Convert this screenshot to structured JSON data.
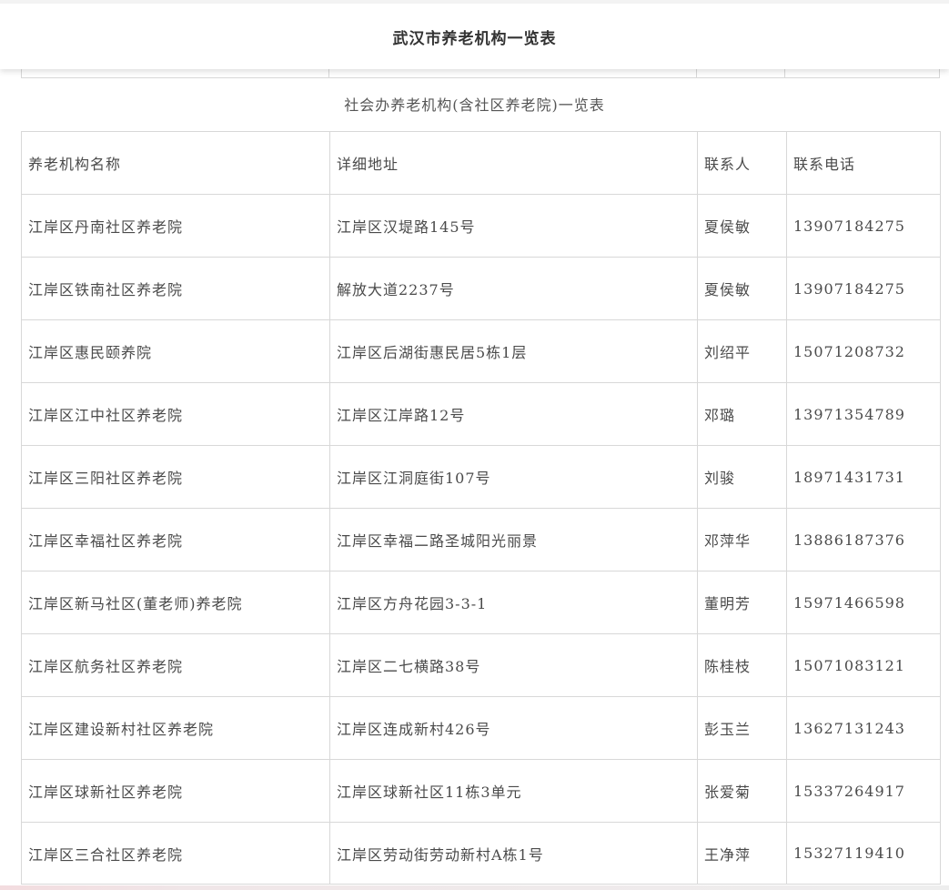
{
  "header": {
    "title": "武汉市养老机构一览表"
  },
  "subtitle": "社会办养老机构(含社区养老院)一览表",
  "table": {
    "columns": [
      "养老机构名称",
      "详细地址",
      "联系人",
      "联系电话"
    ],
    "rows": [
      [
        "江岸区丹南社区养老院",
        "江岸区汉堤路145号",
        "夏侯敏",
        "13907184275"
      ],
      [
        "江岸区铁南社区养老院",
        "解放大道2237号",
        "夏侯敏",
        "13907184275"
      ],
      [
        "江岸区惠民颐养院",
        "江岸区后湖街惠民居5栋1层",
        "刘绍平",
        "15071208732"
      ],
      [
        "江岸区江中社区养老院",
        "江岸区江岸路12号",
        "邓璐",
        "13971354789"
      ],
      [
        "江岸区三阳社区养老院",
        "江岸区江洞庭街107号",
        "刘骏",
        "18971431731"
      ],
      [
        "江岸区幸福社区养老院",
        "江岸区幸福二路圣城阳光丽景",
        "邓萍华",
        "13886187376"
      ],
      [
        "江岸区新马社区(董老师)养老院",
        "江岸区方舟花园3-3-1",
        "董明芳",
        "15971466598"
      ],
      [
        "江岸区航务社区养老院",
        "江岸区二七横路38号",
        "陈桂枝",
        "15071083121"
      ],
      [
        "江岸区建设新村社区养老院",
        "江岸区连成新村426号",
        "彭玉兰",
        "13627131243"
      ],
      [
        "江岸区球新社区养老院",
        "江岸区球新社区11栋3单元",
        "张爱菊",
        "15337264917"
      ],
      [
        "江岸区三合社区养老院",
        "江岸区劳动街劳动新村A栋1号",
        "王净萍",
        "15327119410"
      ]
    ]
  }
}
